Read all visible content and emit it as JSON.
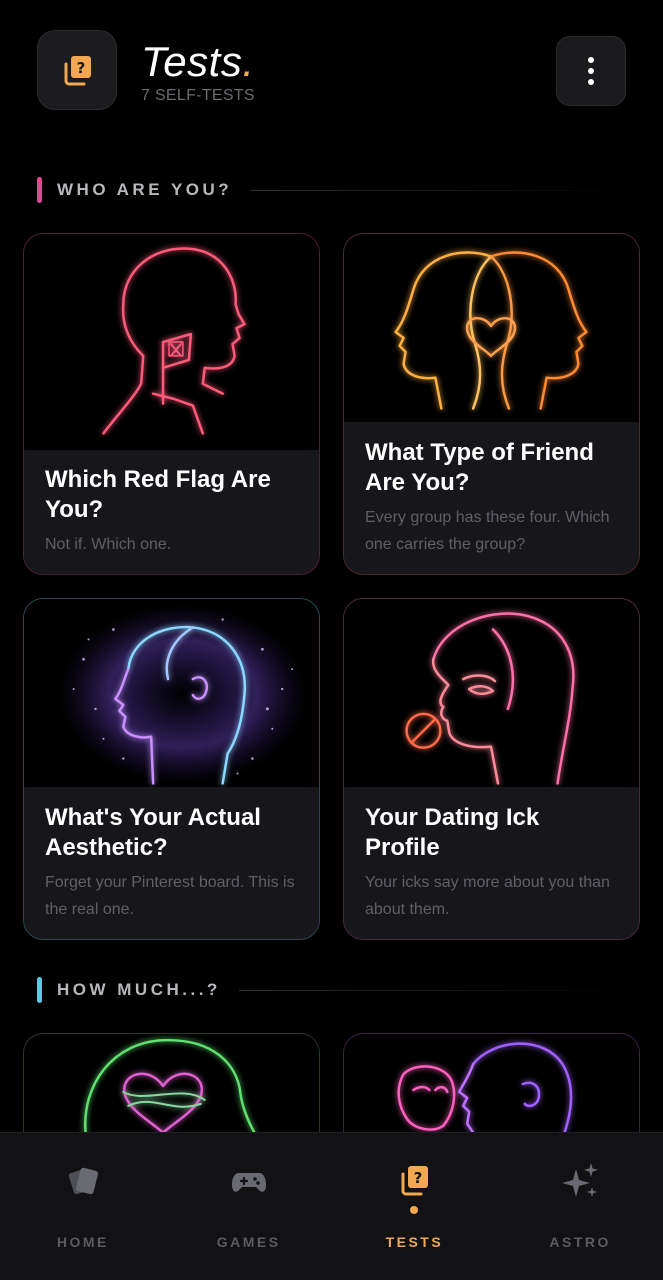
{
  "header": {
    "title": "Tests",
    "title_dot": ".",
    "subtitle": "7 SELF-TESTS",
    "app_icon": "question-cards-icon",
    "menu_icon": "more-vertical-icon"
  },
  "sections": [
    {
      "label": "WHO ARE YOU?",
      "accent": "#e0488f"
    },
    {
      "label": "HOW MUCH...?",
      "accent": "#5ec8e0"
    }
  ],
  "cards": [
    {
      "title": "Which Red Flag Are You?",
      "description": "Not if. Which one.",
      "art": "neon-head-red-flag",
      "border": "#4a2236"
    },
    {
      "title": "What Type of Friend Are You?",
      "description": "Every group has these four. Which one carries the group?",
      "art": "neon-two-heads-heart",
      "border": "#4a2a2e"
    },
    {
      "title": "What's Your Actual Aesthetic?",
      "description": "Forget your Pinterest board. This is the real one.",
      "art": "neon-head-sparkles",
      "border": "#2b4a52"
    },
    {
      "title": "Your Dating Ick Profile",
      "description": "Your icks say more about you than about them.",
      "art": "neon-face-no-kiss",
      "border": "#4a2a3e"
    },
    {
      "title": "",
      "description": "",
      "art": "neon-head-thorn-heart",
      "border": "#2a3a2a"
    },
    {
      "title": "",
      "description": "",
      "art": "neon-faces-masks",
      "border": "#3a2248"
    }
  ],
  "nav": [
    {
      "label": "HOME",
      "icon": "cards-icon",
      "active": false
    },
    {
      "label": "GAMES",
      "icon": "gamepad-icon",
      "active": false
    },
    {
      "label": "TESTS",
      "icon": "question-cards-icon",
      "active": true
    },
    {
      "label": "ASTRO",
      "icon": "sparkles-icon",
      "active": false
    }
  ],
  "colors": {
    "accent": "#f2a851",
    "background": "#000000",
    "card_body": "#17171b"
  }
}
